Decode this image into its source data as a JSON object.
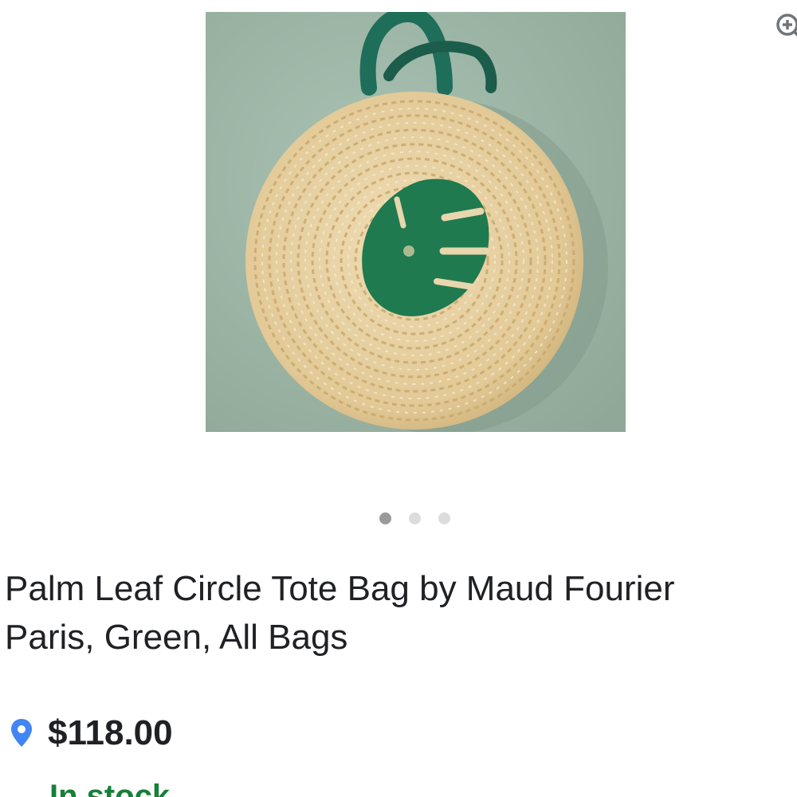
{
  "product": {
    "title": "Palm Leaf Circle Tote Bag by Maud Fourier Paris, Green, All Bags",
    "price": "$118.00",
    "stock_status": "In stock"
  },
  "carousel": {
    "total_images": 3,
    "active_index": 0
  },
  "icons": {
    "zoom": "zoom-in-icon",
    "location": "location-pin-icon"
  },
  "colors": {
    "image_background": "#9fb7a8",
    "leaf_green": "#1f7a4f",
    "pin_blue": "#4285f4",
    "in_stock_green": "#188038",
    "dot_active": "#9a9a9a",
    "dot_inactive": "#dcdcdc"
  }
}
